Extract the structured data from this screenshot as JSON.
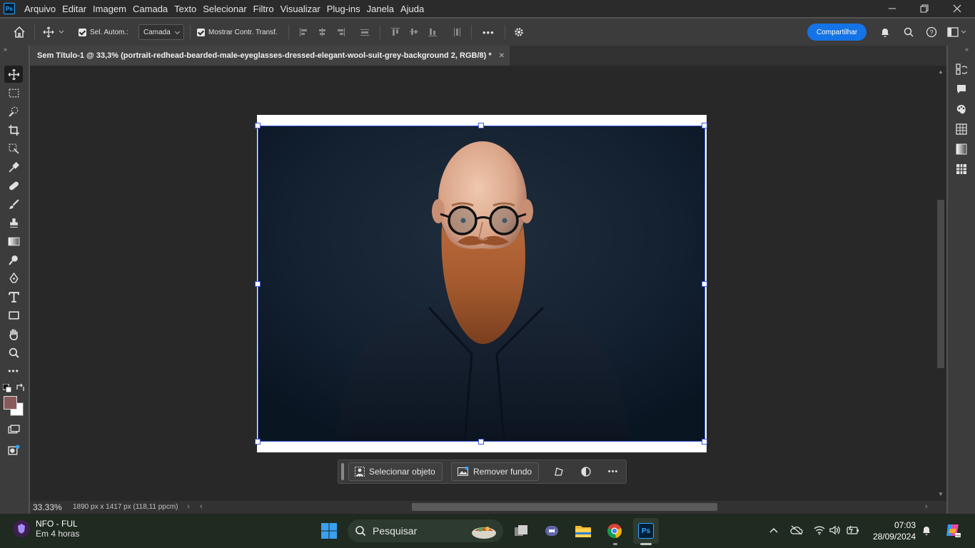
{
  "app": {
    "logo": "Ps",
    "menu": [
      "Arquivo",
      "Editar",
      "Imagem",
      "Camada",
      "Texto",
      "Selecionar",
      "Filtro",
      "Visualizar",
      "Plug-ins",
      "Janela",
      "Ajuda"
    ]
  },
  "window_controls": {
    "minimize": "─",
    "restore": "❐",
    "close": "✕"
  },
  "options_bar": {
    "auto_select_label": "Sel. Autom.:",
    "auto_select_value": "Camada",
    "show_transform_label": "Mostrar Contr. Transf.",
    "more_label": "•••",
    "share_label": "Compartilhar"
  },
  "document": {
    "tab_title": "Sem Título-1 @ 33,3% (portrait-redhead-bearded-male-eyeglasses-dressed-elegant-wool-suit-grey-background 2, RGB/8) *",
    "close_glyph": "✕"
  },
  "toolbar": {
    "collapse_glyph": "»",
    "tools": [
      "move-tool",
      "marquee-tool",
      "quick-selection-tool",
      "crop-tool",
      "frame-tool",
      "eyedropper-tool",
      "healing-brush-tool",
      "brush-tool",
      "clone-stamp-tool",
      "gradient-tool",
      "dodge-tool",
      "pen-tool",
      "type-tool",
      "rectangle-tool",
      "hand-tool",
      "zoom-tool",
      "edit-toolbar"
    ],
    "more_label": "•••",
    "foreground_color": "#8a5a5a",
    "background_color": "#ffffff"
  },
  "context_bar": {
    "select_object_label": "Selecionar objeto",
    "remove_bg_label": "Remover fundo",
    "more_label": "•••"
  },
  "status": {
    "zoom": "33.33%",
    "doc_size": "1890 px x 1417 px (118,11 ppcm)",
    "arrow": "›"
  },
  "taskbar": {
    "weather_title": "NFO - FUL",
    "weather_sub": "Em 4 horas",
    "search_placeholder": "Pesquisar",
    "time": "07:03",
    "date": "28/09/2024"
  },
  "colors": {
    "accent": "#1473e6",
    "selection": "#3b5bdb",
    "panel": "#3c3c3c",
    "canvas": "#282828"
  }
}
